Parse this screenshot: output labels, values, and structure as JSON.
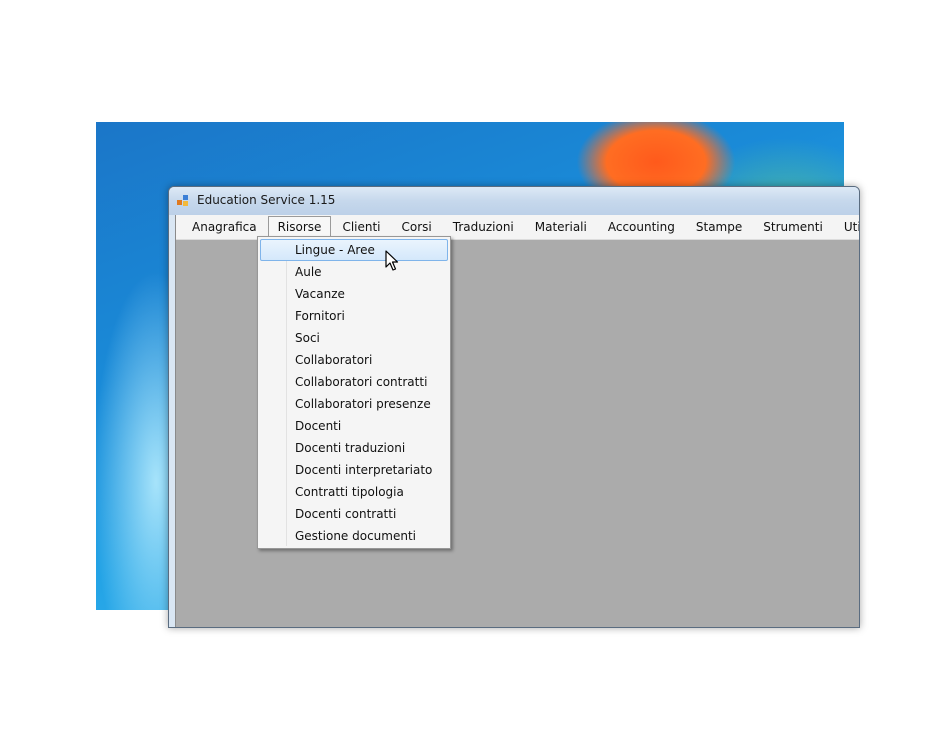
{
  "window": {
    "title": "Education Service 1.15"
  },
  "menubar": {
    "items": [
      {
        "label": "Anagrafica"
      },
      {
        "label": "Risorse"
      },
      {
        "label": "Clienti"
      },
      {
        "label": "Corsi"
      },
      {
        "label": "Traduzioni"
      },
      {
        "label": "Materiali"
      },
      {
        "label": "Accounting"
      },
      {
        "label": "Stampe"
      },
      {
        "label": "Strumenti"
      },
      {
        "label": "Utility"
      },
      {
        "label": "?"
      }
    ],
    "open_menu": "Risorse"
  },
  "risorse_menu": {
    "items": [
      {
        "label": "Lingue - Aree"
      },
      {
        "label": "Aule"
      },
      {
        "label": "Vacanze"
      },
      {
        "label": "Fornitori"
      },
      {
        "label": "Soci"
      },
      {
        "label": "Collaboratori"
      },
      {
        "label": "Collaboratori contratti"
      },
      {
        "label": "Collaboratori presenze"
      },
      {
        "label": "Docenti"
      },
      {
        "label": "Docenti traduzioni"
      },
      {
        "label": "Docenti interpretariato"
      },
      {
        "label": "Contratti tipologia"
      },
      {
        "label": "Docenti contratti"
      },
      {
        "label": "Gestione documenti"
      }
    ],
    "highlighted": "Lingue - Aree"
  },
  "icons": {
    "app": "app-icon",
    "cursor": "mouse-pointer-icon"
  }
}
